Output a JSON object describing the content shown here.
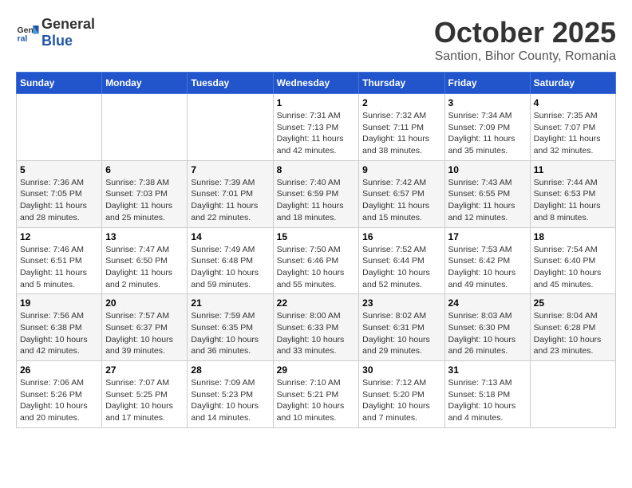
{
  "header": {
    "logo_general": "General",
    "logo_blue": "Blue",
    "month": "October 2025",
    "location": "Santion, Bihor County, Romania"
  },
  "weekdays": [
    "Sunday",
    "Monday",
    "Tuesday",
    "Wednesday",
    "Thursday",
    "Friday",
    "Saturday"
  ],
  "weeks": [
    [
      {
        "day": "",
        "info": ""
      },
      {
        "day": "",
        "info": ""
      },
      {
        "day": "",
        "info": ""
      },
      {
        "day": "1",
        "info": "Sunrise: 7:31 AM\nSunset: 7:13 PM\nDaylight: 11 hours and 42 minutes."
      },
      {
        "day": "2",
        "info": "Sunrise: 7:32 AM\nSunset: 7:11 PM\nDaylight: 11 hours and 38 minutes."
      },
      {
        "day": "3",
        "info": "Sunrise: 7:34 AM\nSunset: 7:09 PM\nDaylight: 11 hours and 35 minutes."
      },
      {
        "day": "4",
        "info": "Sunrise: 7:35 AM\nSunset: 7:07 PM\nDaylight: 11 hours and 32 minutes."
      }
    ],
    [
      {
        "day": "5",
        "info": "Sunrise: 7:36 AM\nSunset: 7:05 PM\nDaylight: 11 hours and 28 minutes."
      },
      {
        "day": "6",
        "info": "Sunrise: 7:38 AM\nSunset: 7:03 PM\nDaylight: 11 hours and 25 minutes."
      },
      {
        "day": "7",
        "info": "Sunrise: 7:39 AM\nSunset: 7:01 PM\nDaylight: 11 hours and 22 minutes."
      },
      {
        "day": "8",
        "info": "Sunrise: 7:40 AM\nSunset: 6:59 PM\nDaylight: 11 hours and 18 minutes."
      },
      {
        "day": "9",
        "info": "Sunrise: 7:42 AM\nSunset: 6:57 PM\nDaylight: 11 hours and 15 minutes."
      },
      {
        "day": "10",
        "info": "Sunrise: 7:43 AM\nSunset: 6:55 PM\nDaylight: 11 hours and 12 minutes."
      },
      {
        "day": "11",
        "info": "Sunrise: 7:44 AM\nSunset: 6:53 PM\nDaylight: 11 hours and 8 minutes."
      }
    ],
    [
      {
        "day": "12",
        "info": "Sunrise: 7:46 AM\nSunset: 6:51 PM\nDaylight: 11 hours and 5 minutes."
      },
      {
        "day": "13",
        "info": "Sunrise: 7:47 AM\nSunset: 6:50 PM\nDaylight: 11 hours and 2 minutes."
      },
      {
        "day": "14",
        "info": "Sunrise: 7:49 AM\nSunset: 6:48 PM\nDaylight: 10 hours and 59 minutes."
      },
      {
        "day": "15",
        "info": "Sunrise: 7:50 AM\nSunset: 6:46 PM\nDaylight: 10 hours and 55 minutes."
      },
      {
        "day": "16",
        "info": "Sunrise: 7:52 AM\nSunset: 6:44 PM\nDaylight: 10 hours and 52 minutes."
      },
      {
        "day": "17",
        "info": "Sunrise: 7:53 AM\nSunset: 6:42 PM\nDaylight: 10 hours and 49 minutes."
      },
      {
        "day": "18",
        "info": "Sunrise: 7:54 AM\nSunset: 6:40 PM\nDaylight: 10 hours and 45 minutes."
      }
    ],
    [
      {
        "day": "19",
        "info": "Sunrise: 7:56 AM\nSunset: 6:38 PM\nDaylight: 10 hours and 42 minutes."
      },
      {
        "day": "20",
        "info": "Sunrise: 7:57 AM\nSunset: 6:37 PM\nDaylight: 10 hours and 39 minutes."
      },
      {
        "day": "21",
        "info": "Sunrise: 7:59 AM\nSunset: 6:35 PM\nDaylight: 10 hours and 36 minutes."
      },
      {
        "day": "22",
        "info": "Sunrise: 8:00 AM\nSunset: 6:33 PM\nDaylight: 10 hours and 33 minutes."
      },
      {
        "day": "23",
        "info": "Sunrise: 8:02 AM\nSunset: 6:31 PM\nDaylight: 10 hours and 29 minutes."
      },
      {
        "day": "24",
        "info": "Sunrise: 8:03 AM\nSunset: 6:30 PM\nDaylight: 10 hours and 26 minutes."
      },
      {
        "day": "25",
        "info": "Sunrise: 8:04 AM\nSunset: 6:28 PM\nDaylight: 10 hours and 23 minutes."
      }
    ],
    [
      {
        "day": "26",
        "info": "Sunrise: 7:06 AM\nSunset: 5:26 PM\nDaylight: 10 hours and 20 minutes."
      },
      {
        "day": "27",
        "info": "Sunrise: 7:07 AM\nSunset: 5:25 PM\nDaylight: 10 hours and 17 minutes."
      },
      {
        "day": "28",
        "info": "Sunrise: 7:09 AM\nSunset: 5:23 PM\nDaylight: 10 hours and 14 minutes."
      },
      {
        "day": "29",
        "info": "Sunrise: 7:10 AM\nSunset: 5:21 PM\nDaylight: 10 hours and 10 minutes."
      },
      {
        "day": "30",
        "info": "Sunrise: 7:12 AM\nSunset: 5:20 PM\nDaylight: 10 hours and 7 minutes."
      },
      {
        "day": "31",
        "info": "Sunrise: 7:13 AM\nSunset: 5:18 PM\nDaylight: 10 hours and 4 minutes."
      },
      {
        "day": "",
        "info": ""
      }
    ]
  ]
}
